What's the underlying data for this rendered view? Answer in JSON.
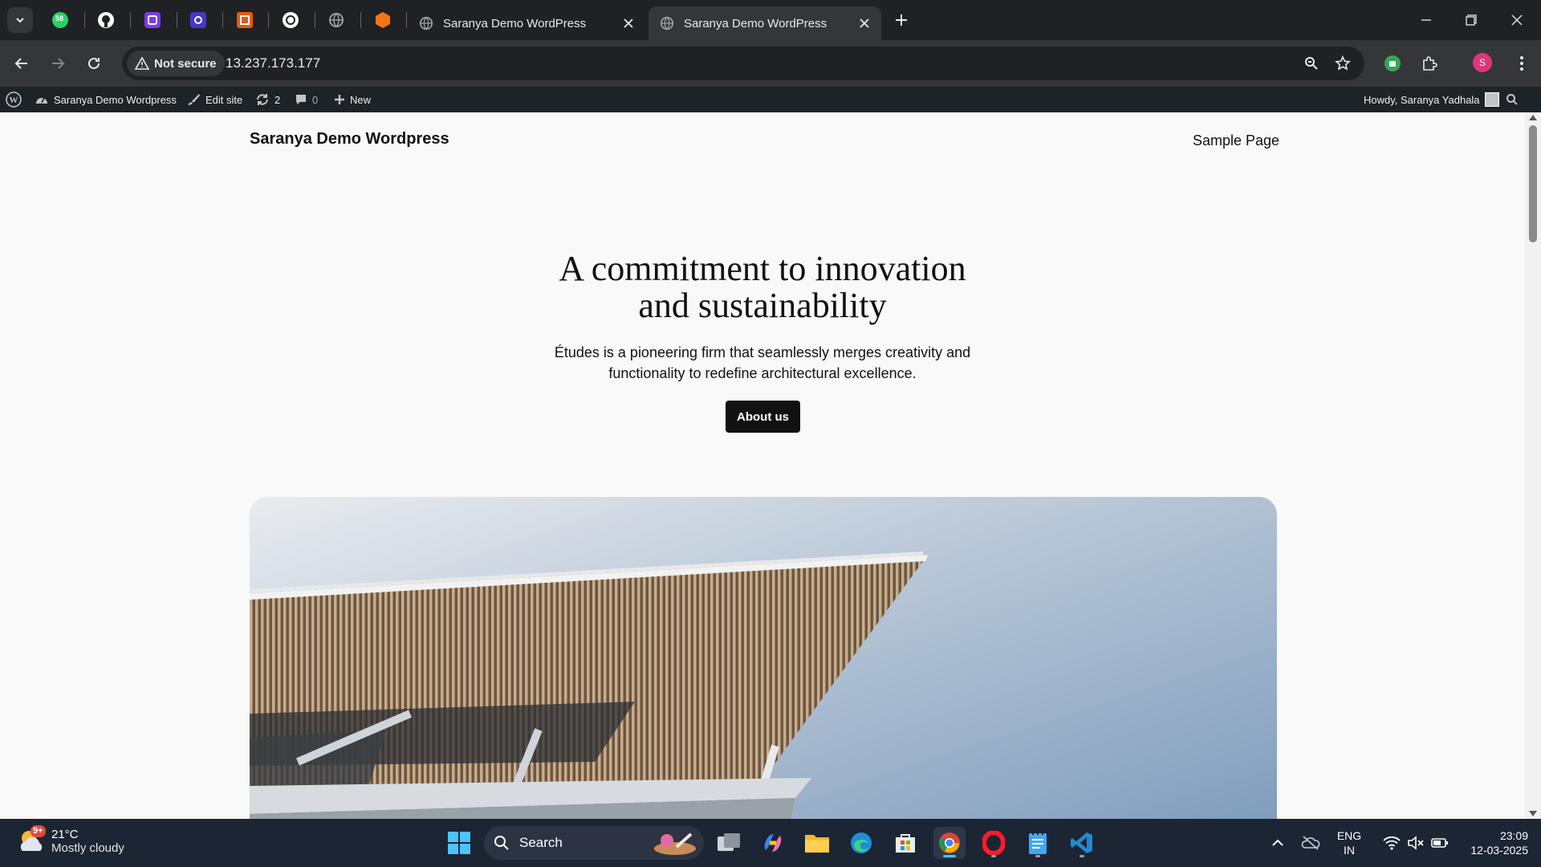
{
  "browser": {
    "tabs": [
      {
        "title": "Saranya Demo WordPress",
        "active": false
      },
      {
        "title": "Saranya Demo WordPress",
        "active": true
      }
    ],
    "whatsapp_badge": "58",
    "security_label": "Not secure",
    "url": "13.237.173.177",
    "profile_initial": "S"
  },
  "admin_bar": {
    "site_name": "Saranya Demo Wordpress",
    "edit_site": "Edit site",
    "updates_count": "2",
    "comments_count": "0",
    "new_label": "New",
    "howdy": "Howdy, Saranya Yadhala"
  },
  "site": {
    "title": "Saranya Demo Wordpress",
    "nav_sample_page": "Sample Page",
    "hero_heading_line1": "A commitment to innovation",
    "hero_heading_line2": "and sustainability",
    "hero_text_line1": "Études is a pioneering firm that seamlessly merges creativity and",
    "hero_text_line2": "functionality to redefine architectural excellence.",
    "hero_button": "About us"
  },
  "taskbar": {
    "weather_badge": "9+",
    "temperature": "21°C",
    "condition": "Mostly cloudy",
    "search_label": "Search",
    "language_line1": "ENG",
    "language_line2": "IN",
    "time": "23:09",
    "date": "12-03-2025"
  },
  "colors": {
    "browser_bg": "#202124",
    "toolbar_bg": "#35363a",
    "admin_bar_bg": "#1d2327",
    "page_bg": "#f9f9f9",
    "button_bg": "#111111",
    "taskbar_bg": "#1c2533",
    "profile_pink": "#e2347a"
  }
}
